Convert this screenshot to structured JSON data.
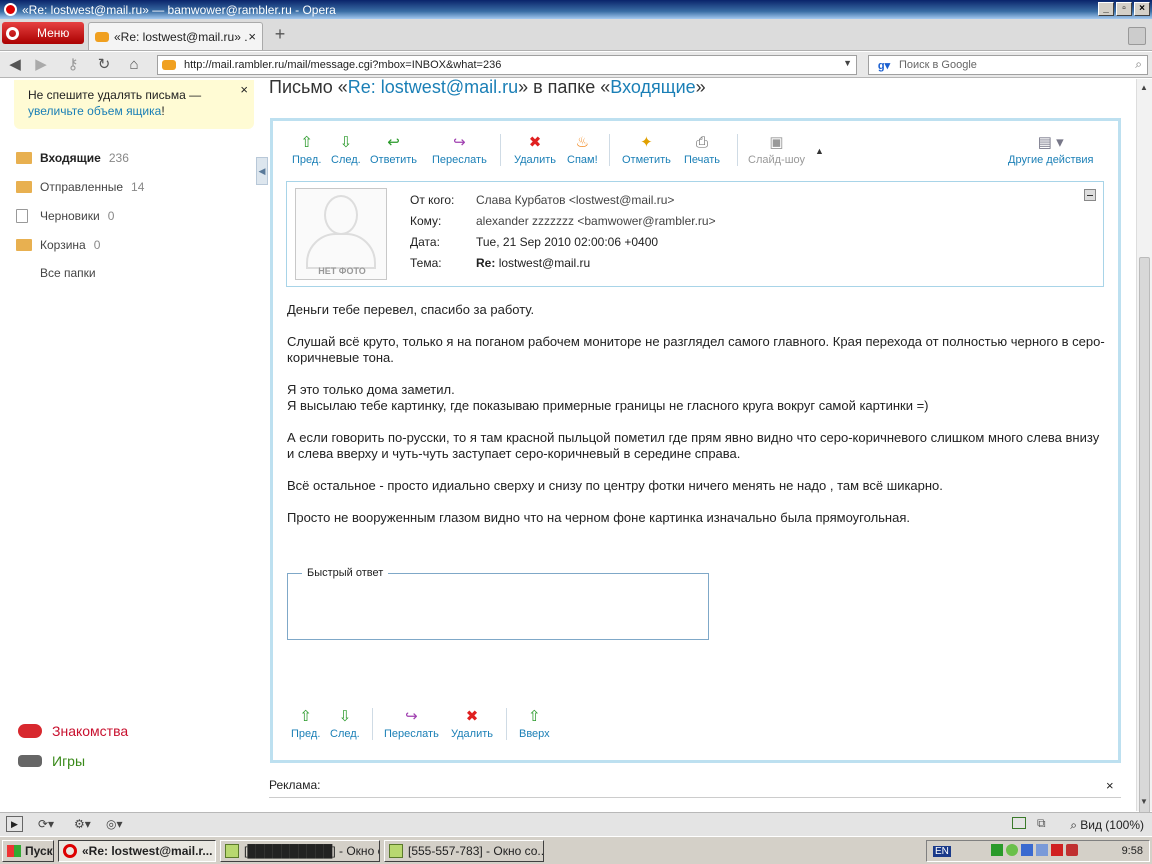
{
  "window": {
    "title": "«Re: lostwest@mail.ru» — bamwower@rambler.ru - Opera"
  },
  "browser": {
    "menu_label": "Меню",
    "tab_title": "«Re: lostwest@mail.ru» ...",
    "url": "http://mail.rambler.ru/mail/message.cgi?mbox=INBOX&what=236",
    "search_placeholder": "Поиск в Google",
    "zoom": "Вид (100%)"
  },
  "sidebar": {
    "notice_text": "Не спешите удалять письма —",
    "notice_link": "увеличьте объем ящика",
    "notice_tail": "!",
    "folders": [
      {
        "name": "Входящие",
        "count": "236"
      },
      {
        "name": "Отправленные",
        "count": "14"
      },
      {
        "name": "Черновики",
        "count": "0"
      },
      {
        "name": "Корзина",
        "count": "0"
      }
    ],
    "all_folders": "Все папки",
    "promo": [
      {
        "label": "Знакомства",
        "color": "#c8102e"
      },
      {
        "label": "Игры",
        "color": "#3a8a1a"
      }
    ]
  },
  "page": {
    "title_prefix": "Письмо «",
    "title_subject": "Re: lostwest@mail.ru",
    "title_mid": "» в папке «",
    "title_folder": "Входящие",
    "title_suffix": "»"
  },
  "toolbar": {
    "prev": "Пред.",
    "next": "След.",
    "reply": "Ответить",
    "forward": "Переслать",
    "delete": "Удалить",
    "spam": "Спам!",
    "mark": "Отметить",
    "print": "Печать",
    "slideshow": "Слайд-шоу",
    "other": "Другие действия",
    "up": "Вверх"
  },
  "message": {
    "no_photo": "НЕТ ФОТО",
    "from_label": "От кого:",
    "from": "Слава Курбатов <lostwest@mail.ru>",
    "to_label": "Кому:",
    "to": "alexander zzzzzzz <bamwower@rambler.ru>",
    "date_label": "Дата:",
    "date": "Tue, 21 Sep 2010 02:00:06 +0400",
    "subject_label": "Тема:",
    "subject_re": "Re:",
    "subject": "lostwest@mail.ru",
    "body": [
      "Деньги тебе перевел, спасибо за работу.",
      "Слушай всё круто, только я на поганом рабочем мониторе не разглядел самого главного. Края перехода от полностью черного в серо-коричневые тона.",
      "Я это только дома заметил.\nЯ высылаю тебе картинку, где показываю примерные границы не гласного круга вокруг самой картинки =)",
      "А если говорить по-русски, то я там красной пыльцой пометил где прям явно видно что серо-коричневого слишком много слева внизу и слева вверху и чуть-чуть заступает серо-коричневый в середине справа.",
      "Всё остальное - просто идиально сверху и снизу по центру фотки ничего менять не надо , там всё шикарно.",
      "Просто не вооруженным глазом видно что на черном фоне картинка изначально была прямоугольная."
    ],
    "quick_reply": "Быстрый ответ"
  },
  "ad": {
    "label": "Реклама:"
  },
  "taskbar": {
    "start": "Пуск",
    "tasks": [
      {
        "label": "«Re: lostwest@mail.r..."
      },
      {
        "label": "[██████████] - Окно со..."
      },
      {
        "label": "[555-557-783] - Окно со..."
      }
    ],
    "lang": "EN",
    "time": "9:58"
  }
}
